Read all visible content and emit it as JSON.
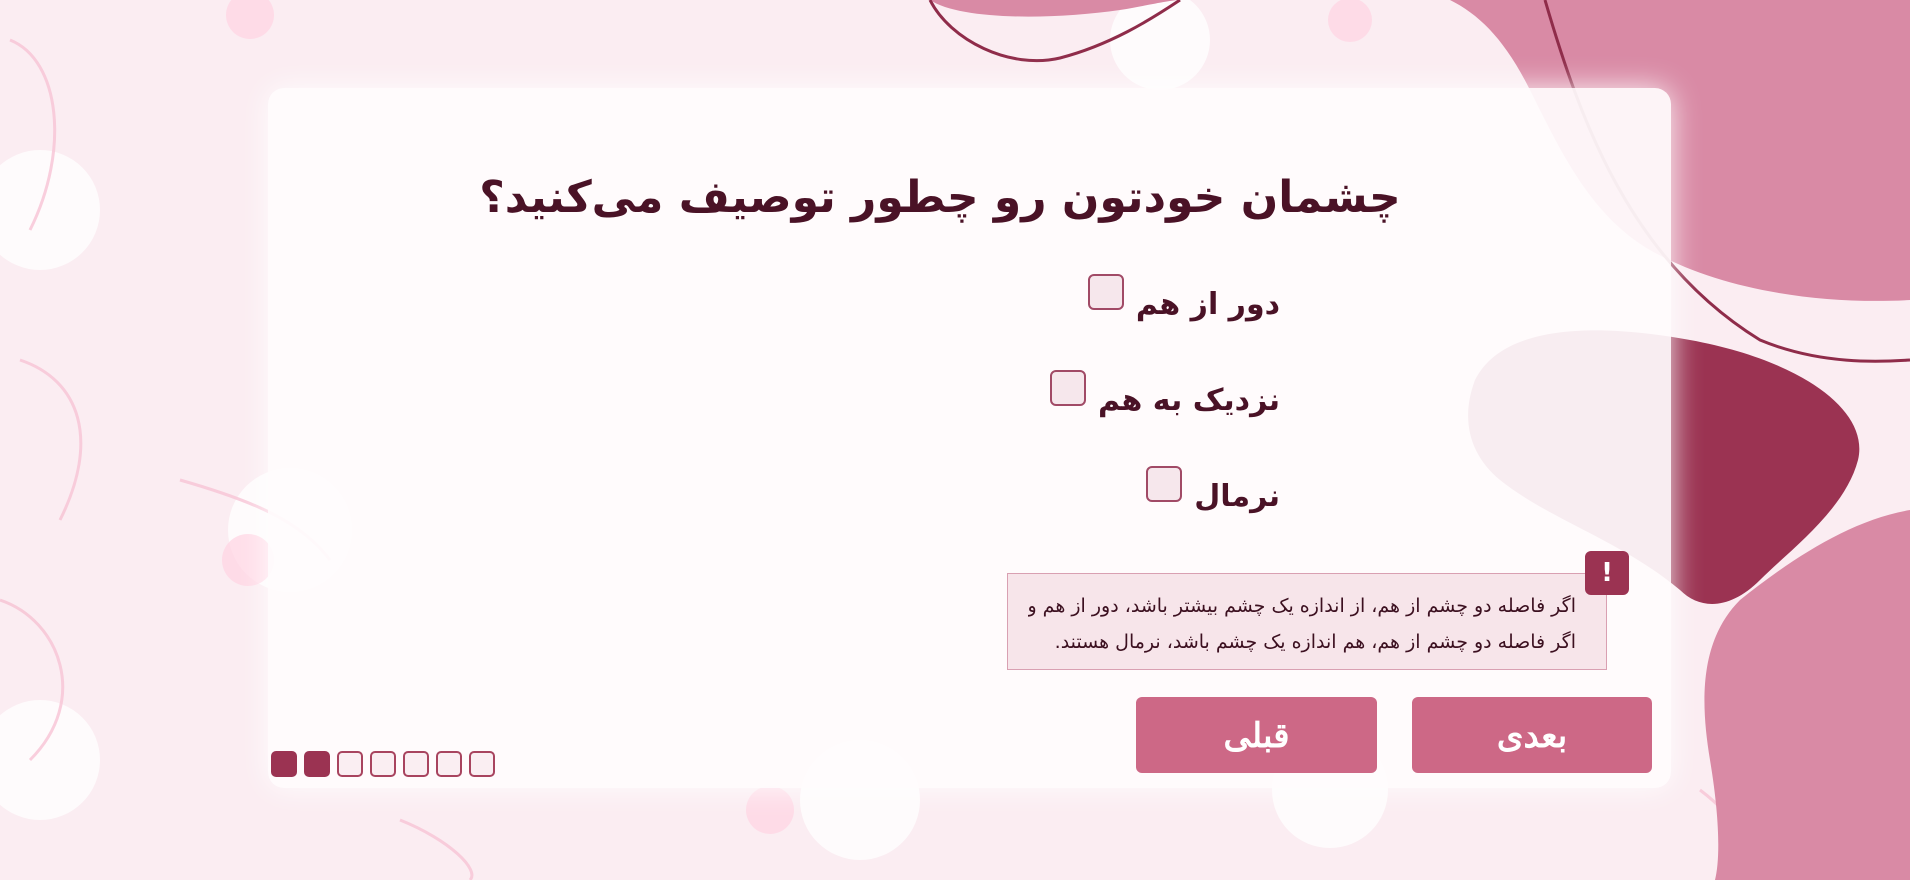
{
  "question": {
    "title": "چشمان خودتون رو چطور توصیف می‌کنید؟"
  },
  "options": [
    {
      "label": "دور از هم",
      "checked": false
    },
    {
      "label": "نزدیک به هم",
      "checked": false
    },
    {
      "label": "نرمال",
      "checked": false
    }
  ],
  "hint": {
    "icon": "!",
    "line1": "اگر فاصله دو چشم از هم، از اندازه یک چشم بیشتر باشد، دور از هم و",
    "line2": "اگر فاصله دو چشم از هم، هم اندازه یک چشم باشد، نرمال هستند."
  },
  "buttons": {
    "next_label": "بعدی",
    "prev_label": "قبلی"
  },
  "progress": {
    "completed": 2,
    "total": 7
  },
  "colors": {
    "accent": "#cd6886",
    "dark_accent": "#9b3352",
    "title_text": "#4a1226",
    "background": "#f9e9ef"
  }
}
